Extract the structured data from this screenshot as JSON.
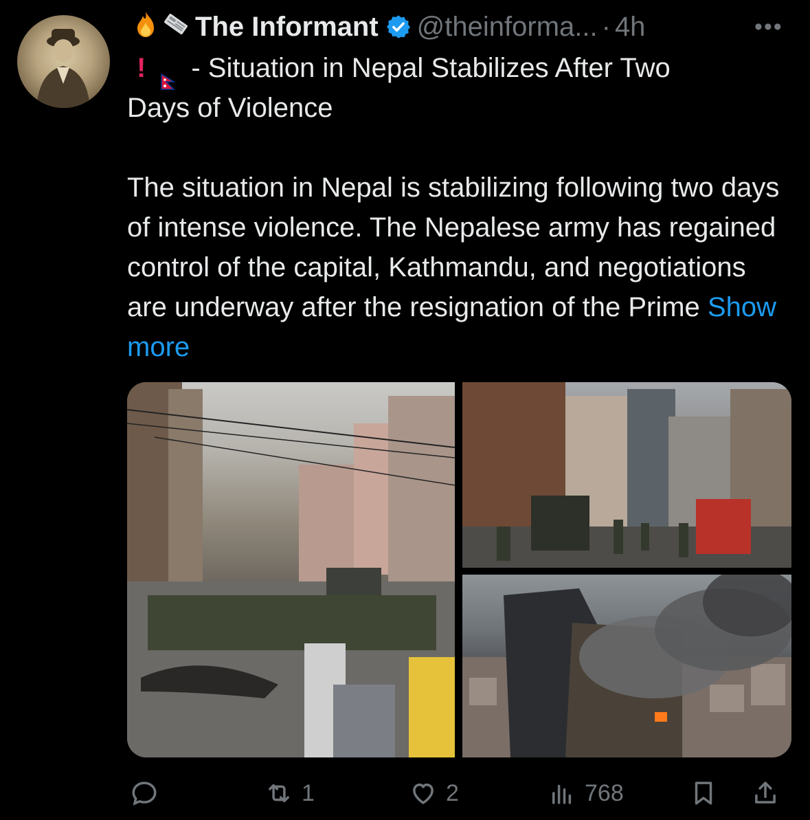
{
  "tweet": {
    "author_name": "The Informant",
    "handle": "@theinforma...",
    "separator": "·",
    "time": "4h",
    "more_label": "•••",
    "name_emojis": [
      "fire-icon",
      "newspaper-icon"
    ],
    "title_prefix": "- Situation in Nepal Stabilizes After Two",
    "title_suffix": "Days of Violence",
    "body": "The situation in Nepal is stabilizing following two days of intense violence. The Nepalese army has regained control of the capital, Kathmandu, and negotiations are underway after the resignation of the Prime",
    "show_more": "Show more",
    "photos": [
      {
        "name": "photo-army-street"
      },
      {
        "name": "photo-soldiers-firetruck"
      },
      {
        "name": "photo-burning-hilton"
      }
    ]
  },
  "actions": {
    "reply_count": "",
    "repost_count": "1",
    "like_count": "2",
    "views_count": "768"
  },
  "colors": {
    "background": "#000000",
    "text": "#e7e9ea",
    "muted": "#71767b",
    "link": "#1d9bf0",
    "verified": "#1d9bf0"
  }
}
